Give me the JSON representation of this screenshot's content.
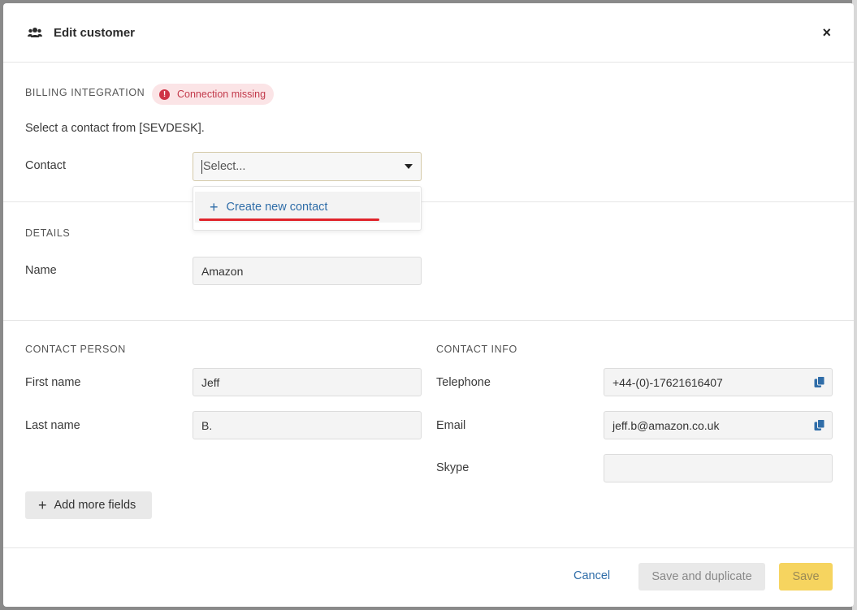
{
  "modal": {
    "title": "Edit customer",
    "header_icon": "users-icon",
    "close_icon": "close-icon",
    "close_label": "×"
  },
  "billing": {
    "section_label": "BILLING INTEGRATION",
    "badge": {
      "text": "Connection missing",
      "icon": "alert-icon",
      "icon_glyph": "!",
      "color": "#c2394a"
    },
    "helper_text": "Select a contact from [SEVDESK].",
    "contact_label": "Contact",
    "select_placeholder": "Select...",
    "dropdown": {
      "item_label": "Create new contact",
      "item_icon": "plus-icon",
      "plus_glyph": "+"
    }
  },
  "details": {
    "section_label": "DETAILS",
    "name_label": "Name",
    "name_value": "Amazon"
  },
  "contact_person": {
    "section_label": "CONTACT PERSON",
    "first_name_label": "First name",
    "first_name_value": "Jeff",
    "last_name_label": "Last name",
    "last_name_value": "B."
  },
  "contact_info": {
    "section_label": "CONTACT INFO",
    "telephone_label": "Telephone",
    "telephone_value": "+44-(0)-17621616407",
    "email_label": "Email",
    "email_value": "jeff.b@amazon.co.uk",
    "skype_label": "Skype",
    "skype_value": "",
    "copy_icon": "copy-icon"
  },
  "add_fields": {
    "label": "Add more fields",
    "plus_glyph": "+"
  },
  "footer": {
    "cancel_label": "Cancel",
    "save_duplicate_label": "Save and duplicate",
    "save_label": "Save"
  },
  "colors": {
    "accent_link": "#2f6da8",
    "save_button": "#f6d45f",
    "error": "#cf3446",
    "highlight_underline": "#e0242b"
  }
}
